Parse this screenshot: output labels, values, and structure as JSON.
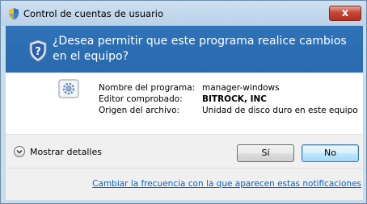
{
  "window": {
    "title": "Control de cuentas de usuario",
    "close_label": "x"
  },
  "header": {
    "question": "¿Desea permitir que este programa realice cambios en el equipo?"
  },
  "program_info": {
    "rows": [
      {
        "label": "Nombre del programa:",
        "value": "manager-windows"
      },
      {
        "label": "Editor comprobado:",
        "value": "BITROCK, INC"
      },
      {
        "label": "Origen del archivo:",
        "value": "Unidad de disco duro en este equipo"
      }
    ]
  },
  "actions": {
    "details_label": "Mostrar detalles",
    "yes_label": "Sí",
    "no_label": "No"
  },
  "footer": {
    "link_text": "Cambiar la frecuencia con la que aparecen estas notificaciones"
  },
  "colors": {
    "header_bg": "#2f73b8",
    "link": "#0066cc",
    "close_button": "#c6473a"
  },
  "icons": [
    "shield-icon",
    "uac-shield-icon",
    "program-icon",
    "chevron-down-icon",
    "close-icon"
  ]
}
